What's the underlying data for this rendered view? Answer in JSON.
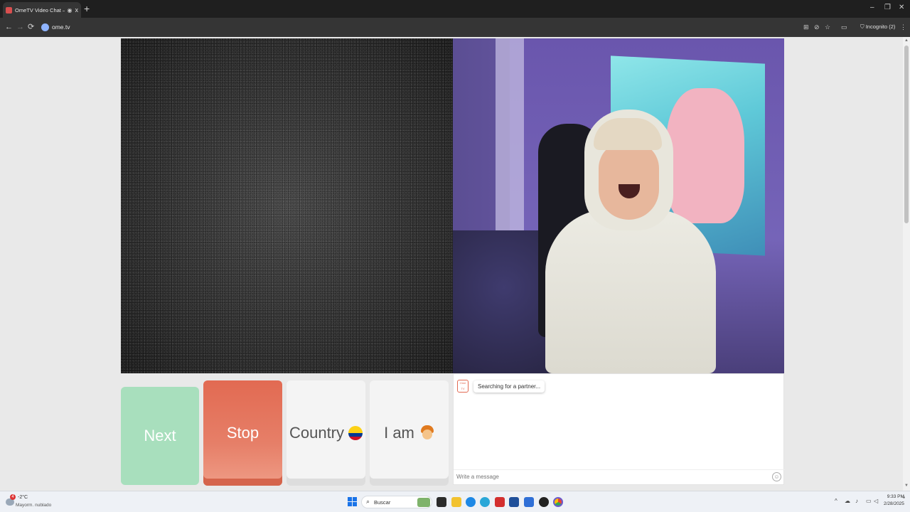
{
  "browser": {
    "tab_title": "OmeTV Video Chat — Ome",
    "audio_icon": "speaker-icon",
    "close_icon": "x",
    "new_tab": "+",
    "url": "ome.tv",
    "profile_label": "Incognito (2)",
    "window_controls": {
      "minimize": "–",
      "restore": "❐",
      "close": "✕"
    },
    "nav": {
      "back": "←",
      "forward": "→",
      "reload": "⟳"
    }
  },
  "controls": {
    "next_label": "Next",
    "stop_label": "Stop",
    "country_label": "Country",
    "iam_label": "I am",
    "country_flag": "colombia-flag",
    "gender_icon": "boy-emoji"
  },
  "chat": {
    "logo_text": "Ome TV",
    "status_message": "Searching for a partner...",
    "input_placeholder": "Write a message",
    "emoji_icon": "☺"
  },
  "taskbar": {
    "weather_temp": "-2°C",
    "weather_condition": "Mayorm. nublado",
    "weather_badge": "4",
    "search_label": "Buscar",
    "time": "9:33 PM",
    "date": "2/28/2025"
  },
  "colors": {
    "next_button": "#a8dfbd",
    "stop_button": "#e26a52",
    "neutral_button": "#f4f4f4",
    "chrome_dark": "#1f1f1f"
  }
}
